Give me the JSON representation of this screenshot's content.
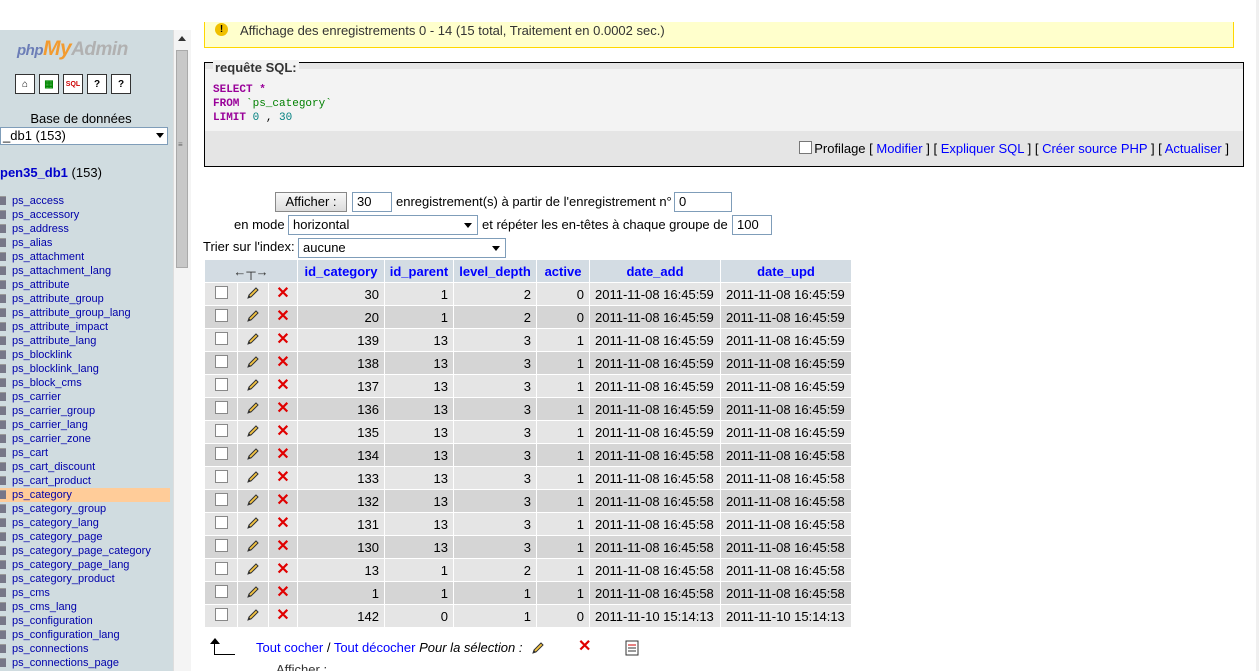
{
  "nav": {
    "logo_php": "php",
    "logo_my": "My",
    "logo_admin": "Admin",
    "quick_icons": [
      "home-icon",
      "sql-query-icon",
      "sql-icon",
      "docs-icon",
      "mysql-docs-icon"
    ],
    "quick_icon_labels": [
      "⌂",
      "▦",
      "SQL",
      "?",
      "?"
    ],
    "db_label": "Base de données",
    "db_select_value": "_db1 (153)",
    "db_name": "pen35_db1",
    "db_count": "(153)",
    "tables": [
      "ps_access",
      "ps_accessory",
      "ps_address",
      "ps_alias",
      "ps_attachment",
      "ps_attachment_lang",
      "ps_attribute",
      "ps_attribute_group",
      "ps_attribute_group_lang",
      "ps_attribute_impact",
      "ps_attribute_lang",
      "ps_blocklink",
      "ps_blocklink_lang",
      "ps_block_cms",
      "ps_carrier",
      "ps_carrier_group",
      "ps_carrier_lang",
      "ps_carrier_zone",
      "ps_cart",
      "ps_cart_discount",
      "ps_cart_product",
      "ps_category",
      "ps_category_group",
      "ps_category_lang",
      "ps_category_page",
      "ps_category_page_category",
      "ps_category_page_lang",
      "ps_category_product",
      "ps_cms",
      "ps_cms_lang",
      "ps_configuration",
      "ps_configuration_lang",
      "ps_connections",
      "ps_connections_page"
    ],
    "active_table": "ps_category"
  },
  "notice": {
    "text": "Affichage des enregistrements 0 - 14 (15 total, Traitement en 0.0002 sec.)"
  },
  "sql": {
    "legend": "requête SQL:",
    "line1_kw": "SELECT",
    "line1_rest": " *",
    "line2_kw": "FROM",
    "line2_rest": " `ps_category`",
    "line3_kw": "LIMIT",
    "line3_n1": " 0",
    "line3_sep": " , ",
    "line3_n2": "30",
    "profiling": "Profilage",
    "links": [
      "Modifier",
      "Expliquer SQL",
      "Créer source PHP",
      "Actualiser"
    ]
  },
  "nav_form": {
    "show_button": "Afficher :",
    "rows_value": "30",
    "rows_text": "enregistrement(s) à partir de l'enregistrement n°",
    "start_value": "0",
    "mode_label": "en mode",
    "mode_value": "horizontal",
    "repeat_text": "et répéter les en-têtes à chaque groupe de",
    "repeat_value": "100",
    "sort_label": "Trier sur l'index:",
    "sort_value": "aucune"
  },
  "table": {
    "columns": [
      "id_category",
      "id_parent",
      "level_depth",
      "active",
      "date_add",
      "date_upd"
    ],
    "rows": [
      [
        "30",
        "1",
        "2",
        "0",
        "2011-11-08 16:45:59",
        "2011-11-08 16:45:59"
      ],
      [
        "20",
        "1",
        "2",
        "0",
        "2011-11-08 16:45:59",
        "2011-11-08 16:45:59"
      ],
      [
        "139",
        "13",
        "3",
        "1",
        "2011-11-08 16:45:59",
        "2011-11-08 16:45:59"
      ],
      [
        "138",
        "13",
        "3",
        "1",
        "2011-11-08 16:45:59",
        "2011-11-08 16:45:59"
      ],
      [
        "137",
        "13",
        "3",
        "1",
        "2011-11-08 16:45:59",
        "2011-11-08 16:45:59"
      ],
      [
        "136",
        "13",
        "3",
        "1",
        "2011-11-08 16:45:59",
        "2011-11-08 16:45:59"
      ],
      [
        "135",
        "13",
        "3",
        "1",
        "2011-11-08 16:45:59",
        "2011-11-08 16:45:59"
      ],
      [
        "134",
        "13",
        "3",
        "1",
        "2011-11-08 16:45:58",
        "2011-11-08 16:45:58"
      ],
      [
        "133",
        "13",
        "3",
        "1",
        "2011-11-08 16:45:58",
        "2011-11-08 16:45:58"
      ],
      [
        "132",
        "13",
        "3",
        "1",
        "2011-11-08 16:45:58",
        "2011-11-08 16:45:58"
      ],
      [
        "131",
        "13",
        "3",
        "1",
        "2011-11-08 16:45:58",
        "2011-11-08 16:45:58"
      ],
      [
        "130",
        "13",
        "3",
        "1",
        "2011-11-08 16:45:58",
        "2011-11-08 16:45:58"
      ],
      [
        "13",
        "1",
        "2",
        "1",
        "2011-11-08 16:45:58",
        "2011-11-08 16:45:58"
      ],
      [
        "1",
        "1",
        "1",
        "1",
        "2011-11-08 16:45:58",
        "2011-11-08 16:45:58"
      ],
      [
        "142",
        "0",
        "1",
        "0",
        "2011-11-10 15:14:13",
        "2011-11-10 15:14:13"
      ]
    ]
  },
  "footer": {
    "check_all": "Tout cocher",
    "separator": " / ",
    "uncheck_all": "Tout décocher",
    "for_selection": "Pour la sélection :"
  },
  "colors": {
    "nav_bg": "#d0dce0",
    "header_bg": "#d3dce3",
    "row_odd": "#e5e5e5",
    "row_even": "#d5d5d5",
    "active_table_bg": "#ffcc99",
    "link": "#0000ff"
  }
}
